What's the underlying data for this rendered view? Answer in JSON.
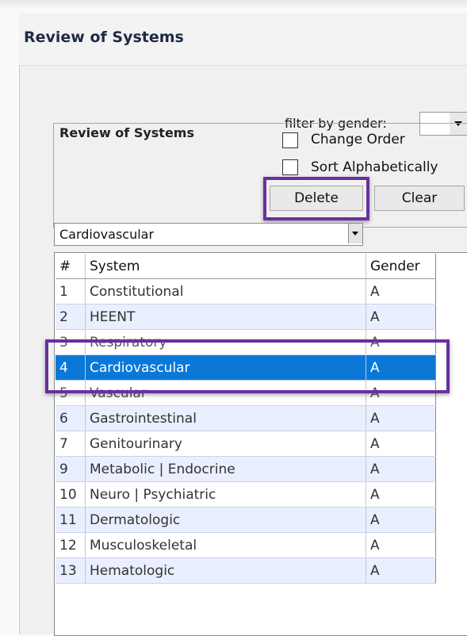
{
  "window": {
    "title": "Review of Systems"
  },
  "filter": {
    "label": "filter by gender:",
    "value": ""
  },
  "panel": {
    "title": "Review of Systems",
    "change_order_label": "Change Order",
    "sort_alpha_label": "Sort Alphabetically",
    "delete_label": "Delete",
    "clear_label": "Clear"
  },
  "combo": {
    "selected": "Cardiovascular"
  },
  "grid": {
    "headers": {
      "num": "#",
      "system": "System",
      "gender": "Gender"
    },
    "rows": [
      {
        "num": "1",
        "system": "Constitutional",
        "gender": "A"
      },
      {
        "num": "2",
        "system": "HEENT",
        "gender": "A"
      },
      {
        "num": "3",
        "system": "Respiratory",
        "gender": "A"
      },
      {
        "num": "4",
        "system": "Cardiovascular",
        "gender": "A"
      },
      {
        "num": "5",
        "system": "Vascular",
        "gender": "A"
      },
      {
        "num": "6",
        "system": "Gastrointestinal",
        "gender": "A"
      },
      {
        "num": "7",
        "system": "Genitourinary",
        "gender": "A"
      },
      {
        "num": "9",
        "system": "Metabolic | Endocrine",
        "gender": "A"
      },
      {
        "num": "10",
        "system": "Neuro | Psychiatric",
        "gender": "A"
      },
      {
        "num": "11",
        "system": "Dermatologic",
        "gender": "A"
      },
      {
        "num": "12",
        "system": "Musculoskeletal",
        "gender": "A"
      },
      {
        "num": "13",
        "system": "Hematologic",
        "gender": "A"
      }
    ]
  },
  "colors": {
    "selection": "#0a78d7",
    "highlight_box": "#6a2fa0",
    "alt_row": "#e9efff"
  }
}
